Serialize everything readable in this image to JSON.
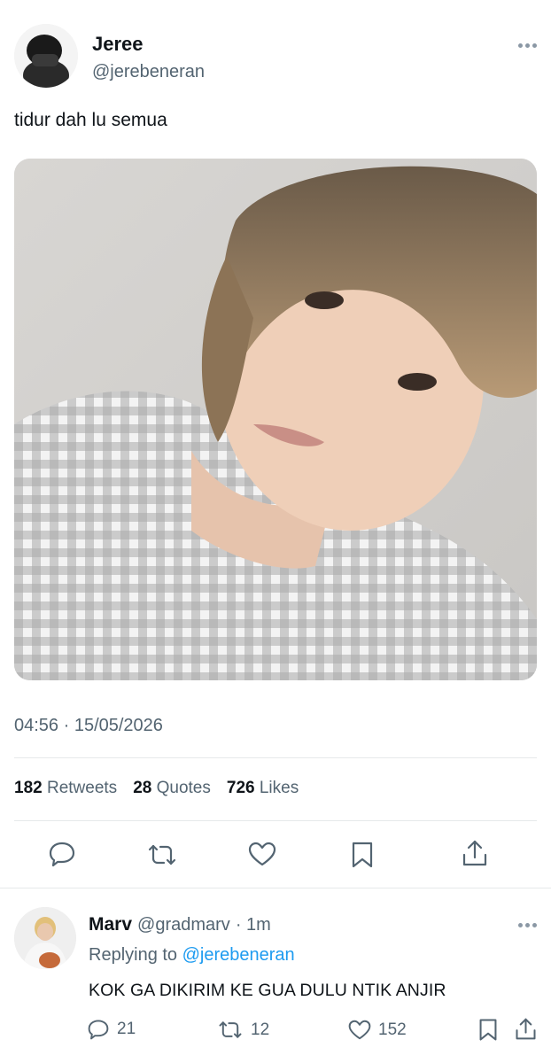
{
  "tweet": {
    "display_name": "Jeree",
    "handle": "@jerebeneran",
    "text": "tidur dah lu semua",
    "timestamp": "04:56 · 15/05/2026",
    "stats": {
      "retweets_count": "182",
      "retweets_label": "Retweets",
      "quotes_count": "28",
      "quotes_label": "Quotes",
      "likes_count": "726",
      "likes_label": "Likes"
    },
    "actions": [
      "reply-icon",
      "retweet-icon",
      "like-icon",
      "bookmark-icon",
      "share-icon"
    ]
  },
  "reply": {
    "display_name": "Marv",
    "handle": "@gradmarv",
    "time": "· 1m",
    "replying_prefix": "Replying to",
    "replying_to": "@jerebeneran",
    "text": "KOK GA DIKIRIM KE GUA DULU NTIK ANJIR",
    "reply_count": "21",
    "retweet_count": "12",
    "like_count": "152"
  },
  "colors": {
    "link": "#1d9bf0",
    "muted": "#536471",
    "text": "#0f1419",
    "divider": "#e6e9ea"
  }
}
